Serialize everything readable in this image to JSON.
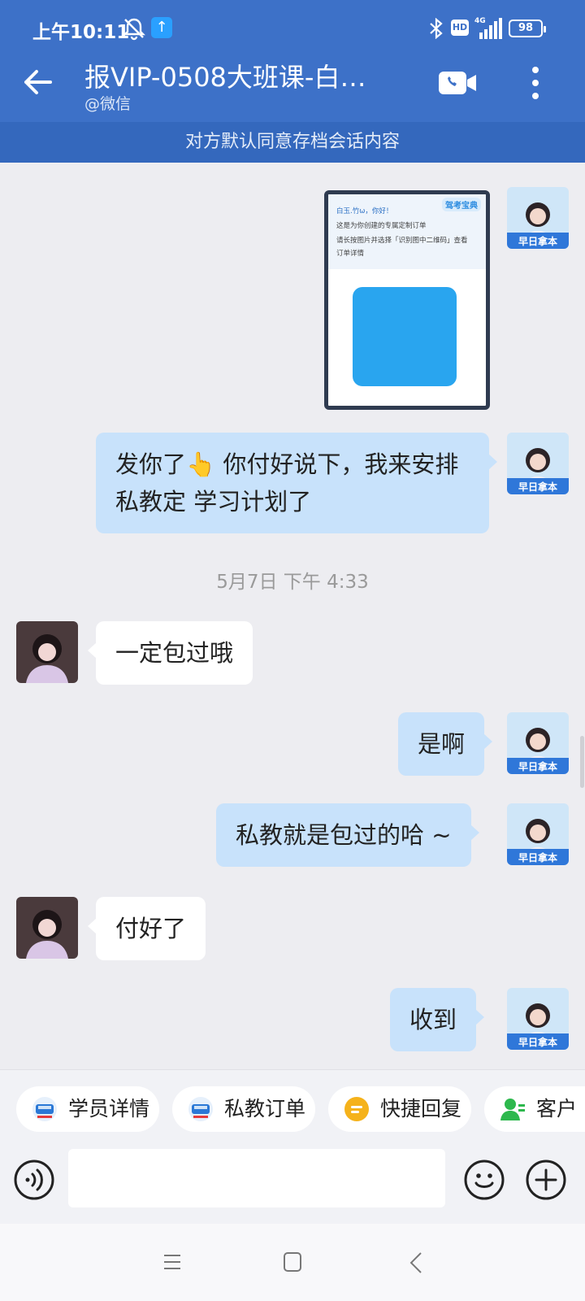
{
  "status_bar": {
    "time": "上午10:11",
    "hd": "HD",
    "battery": "98",
    "upload_arrow": "↑"
  },
  "header": {
    "title": "报VIP-0508大班课-白…",
    "subtitle": "@微信"
  },
  "notice": "对方默认同意存档会话内容",
  "image_message": {
    "brand": "驾考宝典",
    "lines": [
      "白玉.竹ω，你好！",
      "这是为你创建的专属定制订单",
      "请长按图片并选择「识别图中二维码」查看",
      "订单详情"
    ]
  },
  "avatar_badge": "早日拿本",
  "messages": [
    {
      "from": "me",
      "text": "发你了👆 你付好说下，我来安排私教定 学习计划了"
    },
    {
      "from": "them",
      "text": "一定包过哦"
    },
    {
      "from": "me",
      "text": "是啊"
    },
    {
      "from": "me",
      "text": "私教就是包过的哈 ~"
    },
    {
      "from": "them",
      "text": "付好了"
    },
    {
      "from": "me",
      "text": "收到"
    }
  ],
  "timestamp": "5月7日  下午 4:33",
  "quick_actions": [
    {
      "label": "学员详情",
      "icon": "car-icon"
    },
    {
      "label": "私教订单",
      "icon": "car-icon"
    },
    {
      "label": "快捷回复",
      "icon": "quick-reply-icon"
    },
    {
      "label": "客户",
      "icon": "customer-icon"
    }
  ],
  "colors": {
    "header": "#3d71c8",
    "my_bubble": "#c8e2fb",
    "their_bubble": "#ffffff",
    "background": "#ededf1"
  }
}
